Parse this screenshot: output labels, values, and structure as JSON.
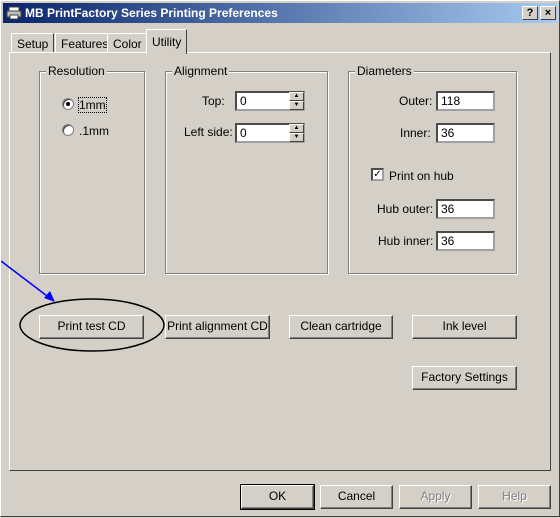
{
  "window": {
    "title": "MB PrintFactory Series Printing Preferences",
    "help_button": "?",
    "close_button": "×"
  },
  "tabs": [
    "Setup",
    "Features",
    "Color",
    "Utility"
  ],
  "active_tab": "Utility",
  "resolution": {
    "label": "Resolution",
    "options": [
      "1mm",
      ".1mm"
    ],
    "selected": "1mm"
  },
  "alignment": {
    "label": "Alignment",
    "top_label": "Top:",
    "top_value": "0",
    "left_label": "Left side:",
    "left_value": "0"
  },
  "diameters": {
    "label": "Diameters",
    "outer_label": "Outer:",
    "outer_value": "118",
    "inner_label": "Inner:",
    "inner_value": "36",
    "print_on_hub_label": "Print on hub",
    "print_on_hub_checked": true,
    "hub_outer_label": "Hub outer:",
    "hub_outer_value": "36",
    "hub_inner_label": "Hub inner:",
    "hub_inner_value": "36"
  },
  "utility_buttons": {
    "print_test_cd": "Print test CD",
    "print_alignment_cd": "Print alignment CD",
    "clean_cartridge": "Clean cartridge",
    "ink_level": "Ink level",
    "factory_settings": "Factory Settings"
  },
  "footer_buttons": {
    "ok": "OK",
    "cancel": "Cancel",
    "apply": "Apply",
    "help": "Help"
  },
  "annotation_color": "#0000ff"
}
